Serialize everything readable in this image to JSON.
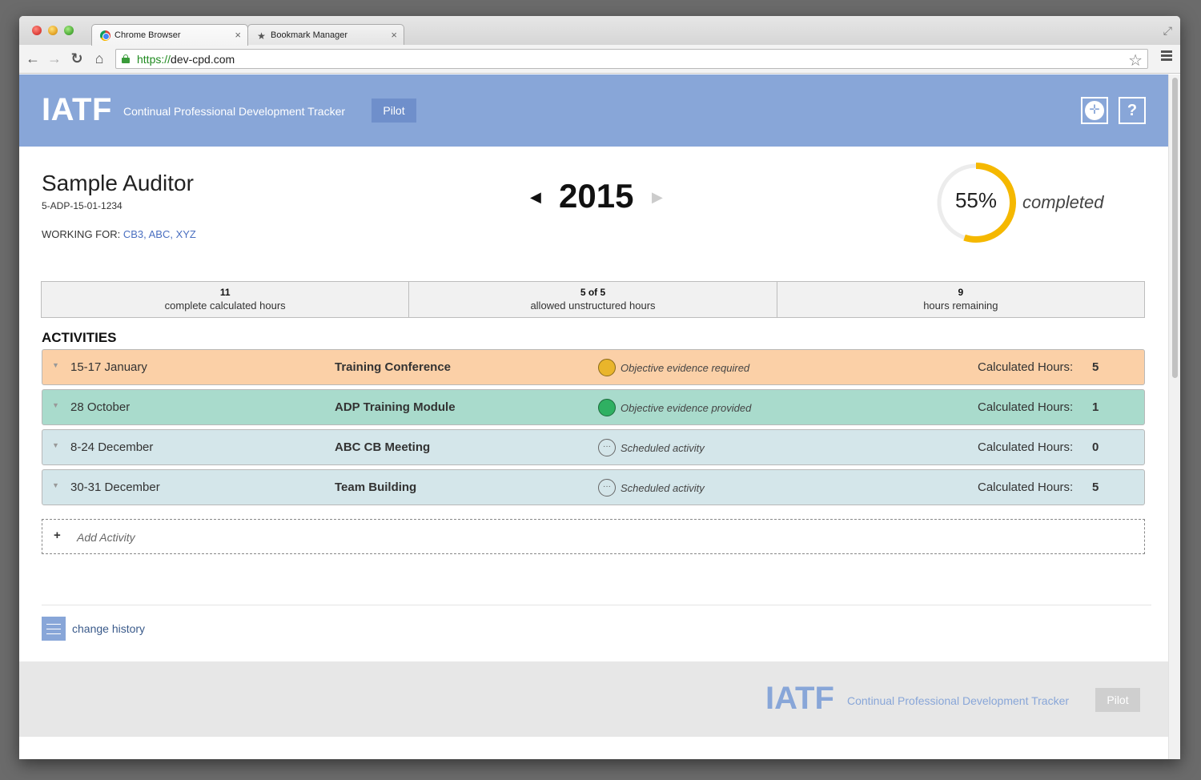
{
  "browser": {
    "tabs": [
      {
        "label": "Chrome Browser",
        "close": "×"
      },
      {
        "label": "Bookmark Manager",
        "close": "×"
      }
    ],
    "url_scheme": "https://",
    "url_host": "dev-cpd.com",
    "nav": {
      "back": "←",
      "forward": "→",
      "reload": "↻",
      "home": "⌂"
    }
  },
  "header": {
    "logo": "IATF",
    "subtitle": "Continual Professional Development Tracker",
    "badge": "Pilot",
    "help": "?"
  },
  "auditor": {
    "name": "Sample Auditor",
    "id": "5-ADP-15-01-1234",
    "working_for_label": "WORKING FOR:",
    "working_for": "CB3, ABC, XYZ"
  },
  "year": {
    "value": "2015",
    "prev": "◀",
    "next": "▶"
  },
  "progress": {
    "percent_label": "55%",
    "percent": 0.55,
    "label": "completed",
    "color": "#f5b800"
  },
  "stats": [
    {
      "num": "11",
      "label": "complete calculated hours"
    },
    {
      "num": "5 of 5",
      "label": "allowed unstructured hours"
    },
    {
      "num": "9",
      "label": "hours remaining"
    }
  ],
  "activities_title": "ACTIVITIES",
  "activities": [
    {
      "date": "15-17 January",
      "title": "Training Conference",
      "status": "Objective evidence required",
      "hours_label": "Calculated Hours:",
      "hours": "5",
      "color": "#fbd0a7",
      "status_icon": "circle-filled-yellow"
    },
    {
      "date": "28 October",
      "title": "ADP Training Module",
      "status": "Objective evidence provided",
      "hours_label": "Calculated Hours:",
      "hours": "1",
      "color": "#a9dbcc",
      "status_icon": "circle-filled-green"
    },
    {
      "date": "8-24 December",
      "title": "ABC CB Meeting",
      "status": "Scheduled activity",
      "hours_label": "Calculated Hours:",
      "hours": "0",
      "color": "#d4e6ea",
      "status_icon": "ellipsis-circle"
    },
    {
      "date": "30-31 December",
      "title": "Team Building",
      "status": "Scheduled activity",
      "hours_label": "Calculated Hours:",
      "hours": "5",
      "color": "#d4e6ea",
      "status_icon": "ellipsis-circle"
    }
  ],
  "add_activity": {
    "plus": "+",
    "label": "Add Activity"
  },
  "history": {
    "label": "change history"
  },
  "footer": {
    "logo": "IATF",
    "subtitle": "Continual Professional Development Tracker",
    "badge": "Pilot"
  },
  "colors": {
    "header": "#88a6d8",
    "accent_link": "#4a6fc0"
  }
}
